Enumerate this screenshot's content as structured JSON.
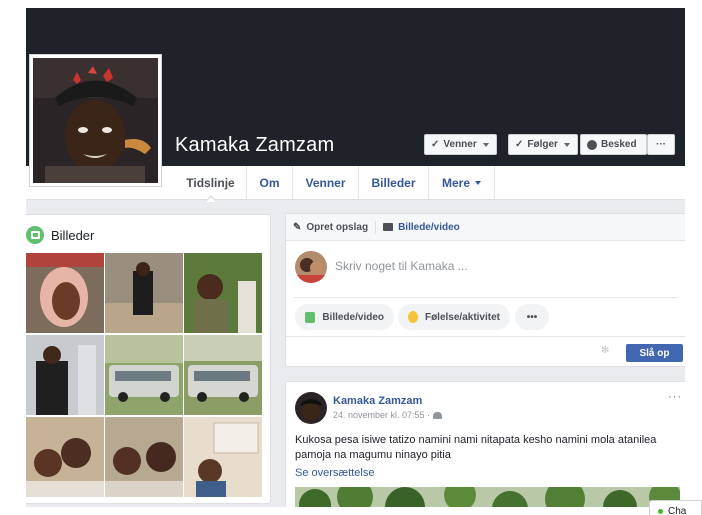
{
  "profile": {
    "name": "Kamaka Zamzam"
  },
  "cover_actions": {
    "friends": "Venner",
    "following": "Følger",
    "message": "Besked",
    "more": "···"
  },
  "tabs": [
    {
      "label": "Tidslinje"
    },
    {
      "label": "Om"
    },
    {
      "label": "Venner"
    },
    {
      "label": "Billeder"
    },
    {
      "label": "Mere"
    }
  ],
  "photos": {
    "title": "Billeder"
  },
  "composer": {
    "tab_post": "Opret opslag",
    "tab_photo": "Billede/video",
    "placeholder": "Skriv noget til Kamaka ...",
    "pill_photo": "Billede/video",
    "pill_feeling": "Følelse/aktivitet",
    "pill_more": "•••",
    "post_button": "Slå op"
  },
  "post": {
    "author": "Kamaka Zamzam",
    "timestamp": "24. november kl. 07:55 ·",
    "text": "Kukosa pesa isiwe tatizo namini nami nitapata kesho namini mola atanilea pamoja na magumu ninayo pitia",
    "translate": "Se oversættelse",
    "more": "···"
  },
  "chat": {
    "label": "Cha"
  },
  "colors": {
    "cover": "#1d2329",
    "link": "#365899",
    "primary_button": "#4267b2",
    "online": "#42b72a"
  }
}
